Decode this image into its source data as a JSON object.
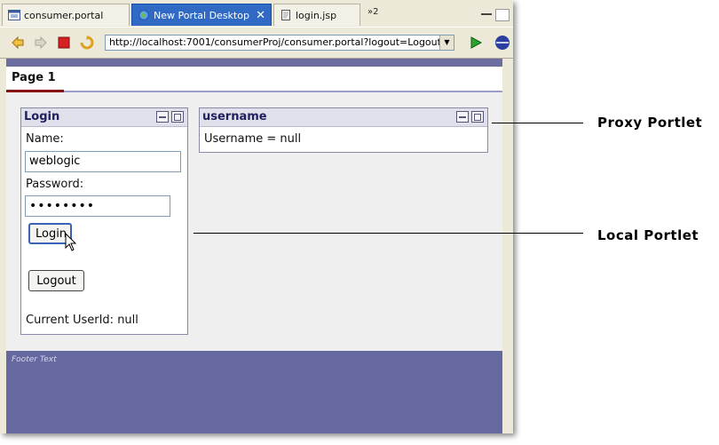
{
  "tabs": [
    {
      "label": "consumer.portal",
      "icon": "portal-file-icon"
    },
    {
      "label": "New Portal Desktop",
      "icon": "globe-icon",
      "close": "✕"
    },
    {
      "label": "login.jsp",
      "icon": "jsp-file-icon"
    }
  ],
  "tab_overflow": "»2",
  "toolbar": {
    "url": "http://localhost:7001/consumerProj/consumer.portal?logout=Logout",
    "url_dropdown": "▼"
  },
  "portal": {
    "page_tab": "Page 1",
    "footer": "Footer Text"
  },
  "login_portlet": {
    "title": "Login",
    "name_label": "Name:",
    "name_value": "weblogic",
    "password_label": "Password:",
    "password_value": "••••••••",
    "login_button": "Login",
    "logout_button": "Logout",
    "status": "Current UserId: null"
  },
  "username_portlet": {
    "title": "username",
    "text": "Username = null"
  },
  "callouts": {
    "proxy": "Proxy Portlet",
    "local": "Local Portlet"
  },
  "colors": {
    "portal_bar": "#6668a0",
    "active_tab": "#316ac5",
    "page_underline": "#8a1111"
  }
}
